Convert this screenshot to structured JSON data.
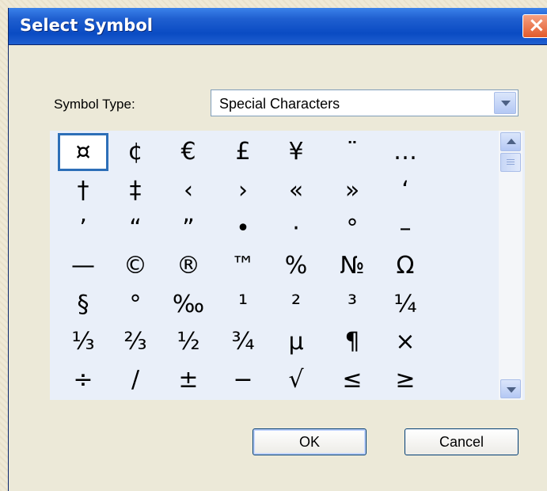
{
  "window": {
    "title": "Select Symbol",
    "close_label": "×"
  },
  "symbol_type": {
    "label": "Symbol Type:",
    "value": "Special Characters"
  },
  "symbols": [
    [
      "¤",
      "¢",
      "€",
      "£",
      "¥",
      "¨",
      "…"
    ],
    [
      "†",
      "‡",
      "‹",
      "›",
      "«",
      "»",
      "‘"
    ],
    [
      "’",
      "“",
      "”",
      "•",
      "·",
      "°",
      "–"
    ],
    [
      "—",
      "©",
      "®",
      "™",
      "%",
      "№",
      "Ω"
    ],
    [
      "§",
      "°",
      "‰",
      "¹",
      "²",
      "³",
      "¼"
    ],
    [
      "⅓",
      "⅔",
      "½",
      "¾",
      "µ",
      "¶",
      "×"
    ],
    [
      "÷",
      "∕",
      "±",
      "−",
      "√",
      "≤",
      "≥"
    ]
  ],
  "selected_symbol": "¤",
  "buttons": {
    "ok": "OK",
    "cancel": "Cancel"
  },
  "colors": {
    "title_bar": "#0a4bc3",
    "selection_border": "#2d6fb8",
    "grid_bg": "#e9eff9"
  }
}
